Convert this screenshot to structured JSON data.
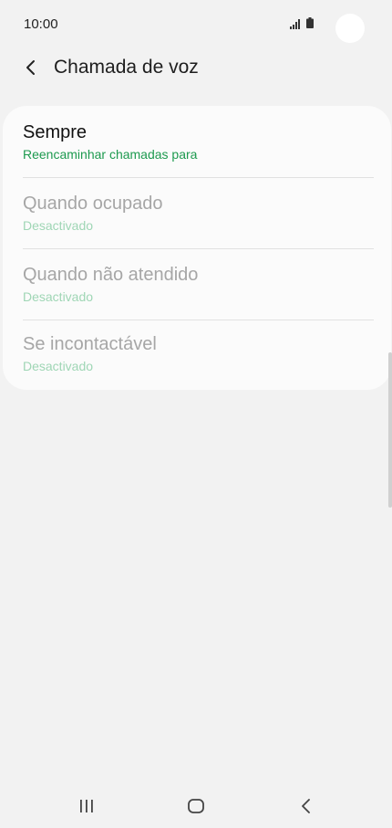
{
  "status": {
    "time": "10:00",
    "icons": [
      "signal-icon",
      "battery-icon"
    ]
  },
  "header": {
    "back_icon": "chevron-left-icon",
    "title": "Chamada de voz"
  },
  "forwarding_options": [
    {
      "title": "Sempre",
      "subtitle": "Reencaminhar chamadas para",
      "enabled": true
    },
    {
      "title": "Quando ocupado",
      "subtitle": "Desactivado",
      "enabled": false
    },
    {
      "title": "Quando não atendido",
      "subtitle": "Desactivado",
      "enabled": false
    },
    {
      "title": "Se incontactável",
      "subtitle": "Desactivado",
      "enabled": false
    }
  ],
  "nav_bar": {
    "items": [
      "recent-apps-icon",
      "home-icon",
      "back-icon"
    ]
  },
  "colors": {
    "accent": "#1d9a4f",
    "accent_disabled": "#9fd6b5",
    "background": "#f2f2f2",
    "card": "#fbfbfb"
  }
}
